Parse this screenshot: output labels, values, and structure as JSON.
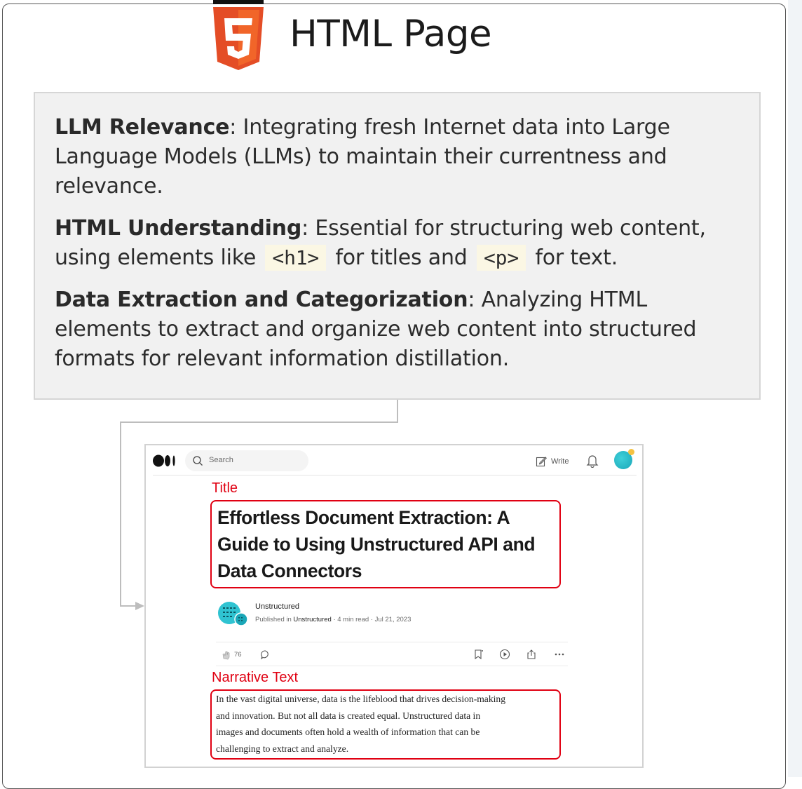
{
  "page": {
    "heading": "HTML Page",
    "logo_icon": "html5-logo-icon",
    "logo_colors": {
      "shield": "#e44d26",
      "shield_light": "#f16529",
      "glyph": "#ffffff",
      "top_text": "#000000"
    }
  },
  "info_box": {
    "paragraphs": [
      {
        "term": "LLM Relevance",
        "text": ": Integrating fresh Internet data into Large Language Models (LLMs) to maintain their currentness and relevance."
      },
      {
        "term": "HTML Understanding",
        "text_before": ": Essential for structuring web content, using elements like",
        "code_1": "<h1>",
        "text_middle": "for titles and",
        "code_2": "<p>",
        "text_after": "for text."
      },
      {
        "term": "Data Extraction and Categorization",
        "text": ": Analyzing HTML elements to extract and organize web content into structured formats for relevant information distillation."
      }
    ]
  },
  "article": {
    "topbar": {
      "logo_icon": "medium-logo-icon",
      "search_placeholder": "Search",
      "write_label": "Write",
      "bell_icon": "bell-icon"
    },
    "title_label": "Title",
    "title": "Effortless Document Extraction: A Guide to Using Unstructured API and Data Connectors",
    "author": {
      "name": "Unstructured",
      "published_prefix": "Published in",
      "publication": "Unstructured",
      "read_time": "4 min read",
      "date": "Jul 21, 2023",
      "separator": "·"
    },
    "actions": {
      "clap_count": "76"
    },
    "narrative_label": "Narrative Text",
    "narrative_lines": [
      "In the vast digital universe, data is the lifeblood that drives decision-making",
      "and innovation. But not all data is created equal. Unstructured data in",
      "images and documents often hold a wealth of information that can be",
      "challenging to extract and analyze."
    ]
  },
  "colors": {
    "highlight_red": "#e00012",
    "box_bg": "#f1f1f1",
    "code_bg": "#fbf7e4",
    "teal": "#1aa7b8"
  }
}
